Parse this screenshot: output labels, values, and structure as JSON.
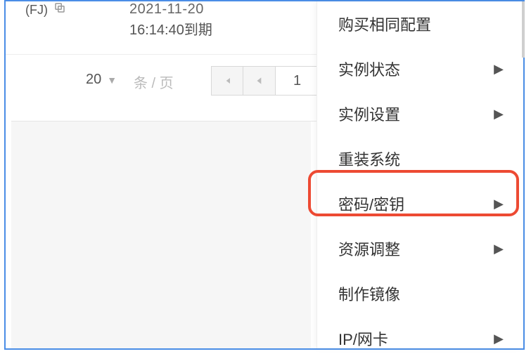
{
  "topRow": {
    "frag": "(FJ)",
    "dateTop": "2021-11-20",
    "expiry": "16:14:40到期"
  },
  "pager": {
    "pageSize": "20",
    "perPageLabel": "条 / 页",
    "currentPage": "1"
  },
  "menu": {
    "items": [
      {
        "label": "购买相同配置",
        "hasSub": false
      },
      {
        "label": "实例状态",
        "hasSub": true
      },
      {
        "label": "实例设置",
        "hasSub": true
      },
      {
        "label": "重装系统",
        "hasSub": false
      },
      {
        "label": "密码/密钥",
        "hasSub": true
      },
      {
        "label": "资源调整",
        "hasSub": true
      },
      {
        "label": "制作镜像",
        "hasSub": false
      },
      {
        "label": "IP/网卡",
        "hasSub": true
      }
    ]
  }
}
